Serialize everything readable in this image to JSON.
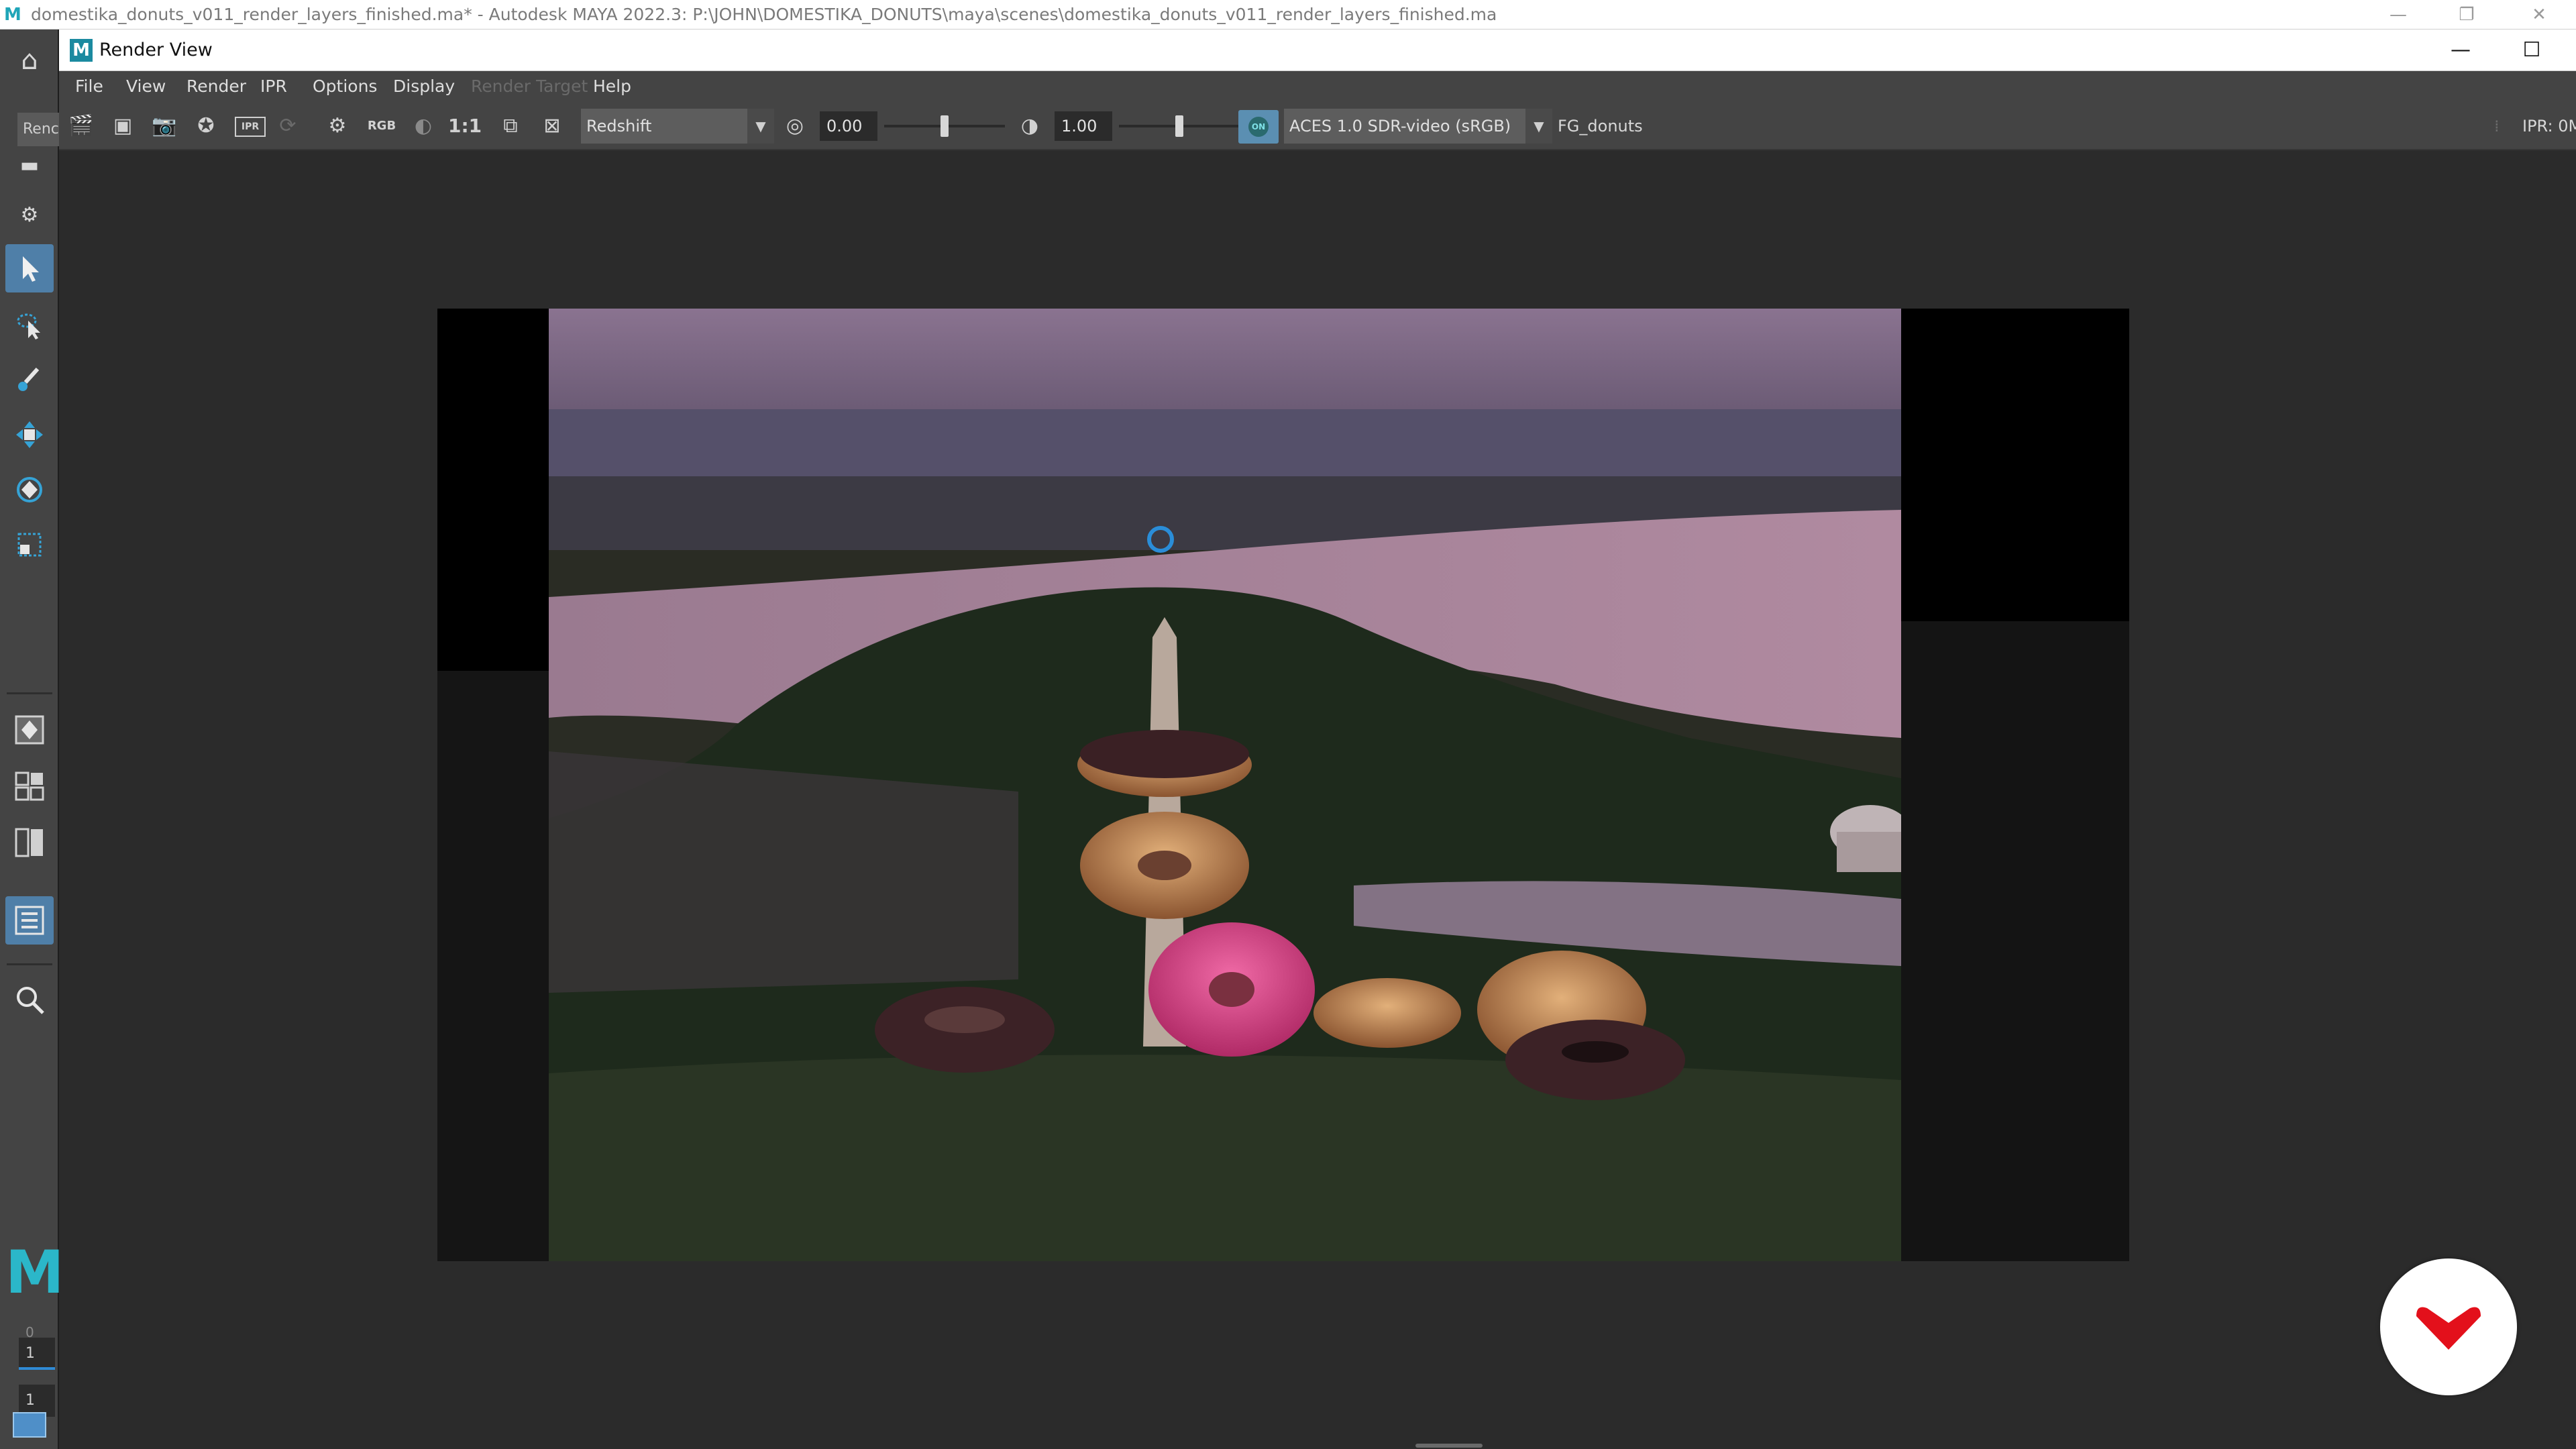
{
  "app_title_bar": {
    "title": "domestika_donuts_v011_render_layers_finished.ma* - Autodesk MAYA 2022.3: P:\\JOHN\\DOMESTIKA_DONUTS\\maya\\scenes\\domestika_donuts_v011_render_layers_finished.ma",
    "logo": "M"
  },
  "left_shelf": {
    "tab_label": "Renc",
    "frame_start": "0",
    "frame_current": "1",
    "frame_end": "1",
    "logo": "M"
  },
  "render_view": {
    "title": "Render View",
    "logo": "M",
    "menus": [
      "File",
      "View",
      "Render",
      "IPR",
      "Options",
      "Display",
      "Render Target",
      "Help"
    ],
    "toolbar": {
      "ratio_label": "1:1",
      "rgb_label": "RGB",
      "ipr_label": "IPR",
      "renderer": "Redshift",
      "exposure": "0.00",
      "gamma": "1.00",
      "exposure_level": 0.5,
      "gamma_level": 0.5,
      "colorspace_on_label": "ON",
      "colorspace": "ACES 1.0 SDR-video (sRGB)",
      "render_layer": "FG_donuts",
      "ipr_status": "IPR: 0M"
    }
  },
  "colors": {
    "accent_blue": "#4f7fa8",
    "maya_teal": "#2bb7c9",
    "domestika_red": "#e3101b"
  }
}
